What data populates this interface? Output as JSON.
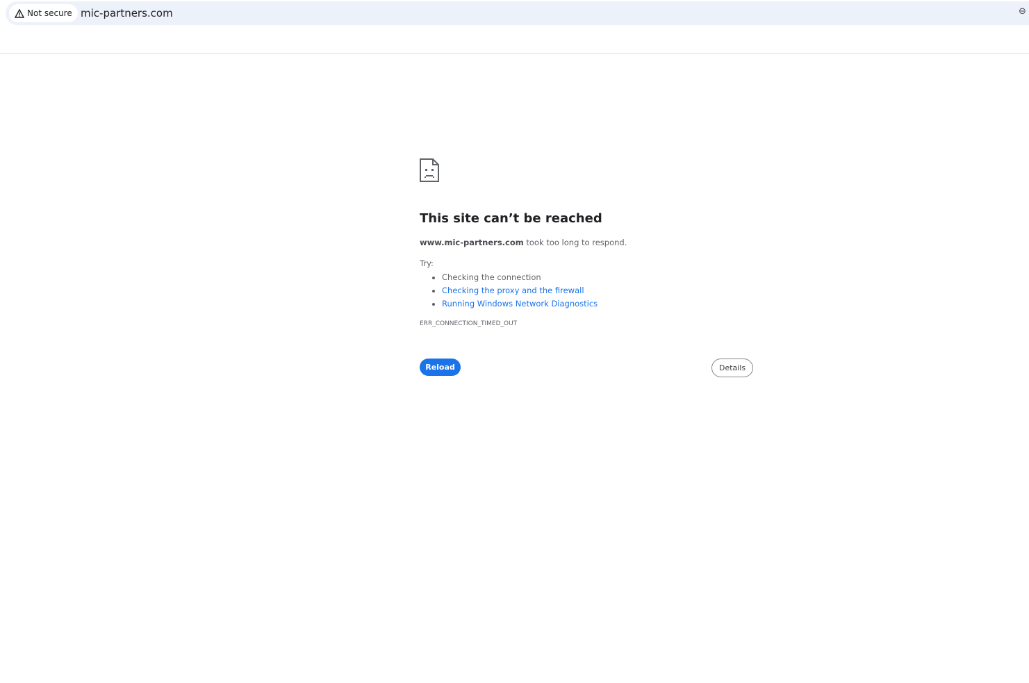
{
  "browser": {
    "security_label": "Not secure",
    "url": "mic-partners.com"
  },
  "error": {
    "title": "This site can’t be reached",
    "host": "www.mic-partners.com",
    "message": " took too long to respond.",
    "try_label": "Try:",
    "suggestions": [
      {
        "text": "Checking the connection",
        "link": false
      },
      {
        "text": "Checking the proxy and the firewall",
        "link": true
      },
      {
        "text": "Running Windows Network Diagnostics",
        "link": true
      }
    ],
    "code": "ERR_CONNECTION_TIMED_OUT",
    "reload_label": "Reload",
    "details_label": "Details"
  }
}
